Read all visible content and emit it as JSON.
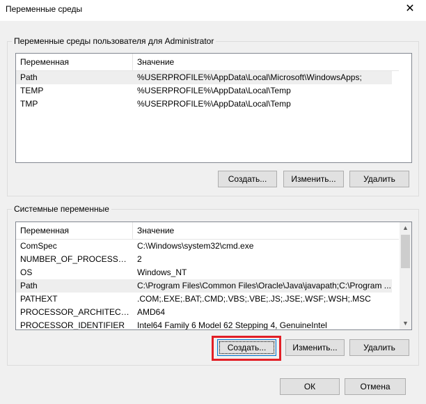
{
  "window": {
    "title": "Переменные среды",
    "close_icon": "close-icon"
  },
  "user_group": {
    "legend": "Переменные среды пользователя для Administrator",
    "columns": [
      "Переменная",
      "Значение"
    ],
    "rows": [
      {
        "name": "Path",
        "value": "%USERPROFILE%\\AppData\\Local\\Microsoft\\WindowsApps;"
      },
      {
        "name": "TEMP",
        "value": "%USERPROFILE%\\AppData\\Local\\Temp"
      },
      {
        "name": "TMP",
        "value": "%USERPROFILE%\\AppData\\Local\\Temp"
      }
    ],
    "buttons": {
      "create": "Создать...",
      "edit": "Изменить...",
      "delete": "Удалить"
    }
  },
  "system_group": {
    "legend": "Системные переменные",
    "columns": [
      "Переменная",
      "Значение"
    ],
    "rows": [
      {
        "name": "ComSpec",
        "value": "C:\\Windows\\system32\\cmd.exe"
      },
      {
        "name": "NUMBER_OF_PROCESSORS",
        "value": "2"
      },
      {
        "name": "OS",
        "value": "Windows_NT"
      },
      {
        "name": "Path",
        "value": "C:\\Program Files\\Common Files\\Oracle\\Java\\javapath;C:\\Program ..."
      },
      {
        "name": "PATHEXT",
        "value": ".COM;.EXE;.BAT;.CMD;.VBS;.VBE;.JS;.JSE;.WSF;.WSH;.MSC"
      },
      {
        "name": "PROCESSOR_ARCHITECTURE",
        "value": "AMD64"
      },
      {
        "name": "PROCESSOR_IDENTIFIER",
        "value": "Intel64 Family 6 Model 62 Stepping 4, GenuineIntel"
      }
    ],
    "buttons": {
      "create": "Создать...",
      "edit": "Изменить...",
      "delete": "Удалить"
    }
  },
  "footer": {
    "ok": "ОК",
    "cancel": "Отмена"
  },
  "colors": {
    "highlight": "#e21f26",
    "selected_row": "#eeeeee",
    "background": "#f0f0f0"
  }
}
